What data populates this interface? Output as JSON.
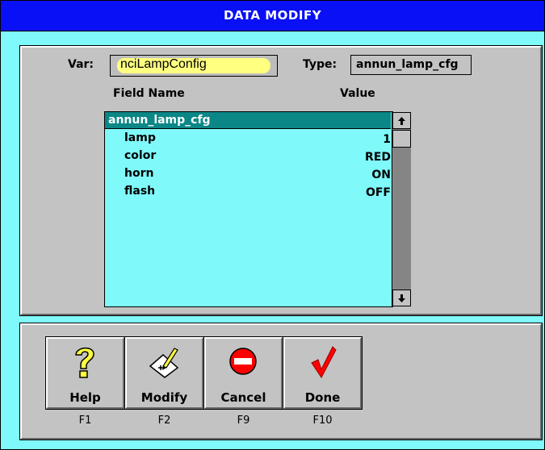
{
  "window": {
    "title": "DATA MODIFY"
  },
  "form": {
    "var_label": "Var:",
    "var_value": "nciLampConfig",
    "type_label": "Type:",
    "type_value": "annun_lamp_cfg",
    "field_name_header": "Field Name",
    "value_header": "Value"
  },
  "list": {
    "header": "annun_lamp_cfg",
    "rows": [
      {
        "name": "lamp",
        "value": "1"
      },
      {
        "name": "color",
        "value": "RED"
      },
      {
        "name": "horn",
        "value": "ON"
      },
      {
        "name": "flash",
        "value": "OFF"
      }
    ]
  },
  "toolbar": [
    {
      "label": "Help",
      "key": "F1",
      "icon": "help-question-icon"
    },
    {
      "label": "Modify",
      "key": "F2",
      "icon": "modify-pencil-icon"
    },
    {
      "label": "Cancel",
      "key": "F9",
      "icon": "cancel-no-entry-icon"
    },
    {
      "label": "Done",
      "key": "F10",
      "icon": "done-checkmark-icon"
    }
  ],
  "colors": {
    "titlebar": "#0a10f5",
    "background": "#7ff9fa",
    "panel": "#c3c3c3",
    "list_header": "#0a8786",
    "highlight": "#ffff80"
  }
}
